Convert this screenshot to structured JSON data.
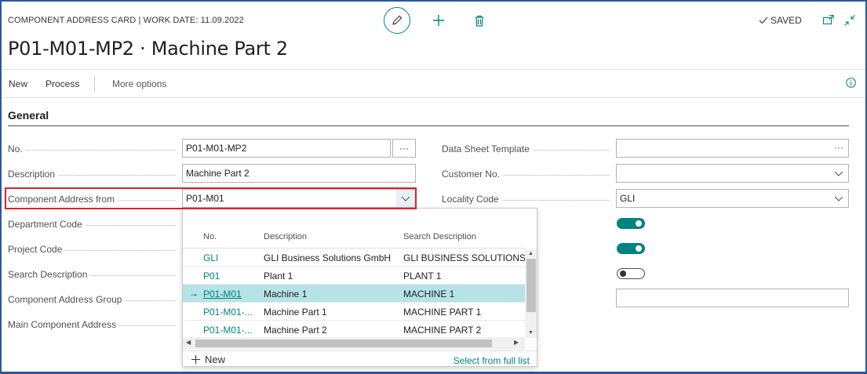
{
  "header": {
    "breadcrumb": "COMPONENT ADDRESS CARD | WORK DATE: 11.09.2022",
    "title": "P01-M01-MP2 · Machine Part 2",
    "saved_label": "SAVED"
  },
  "actions": {
    "new": "New",
    "process": "Process",
    "more": "More options"
  },
  "section": {
    "title": "General"
  },
  "fields": {
    "no": {
      "label": "No.",
      "value": "P01-M01-MP2"
    },
    "description": {
      "label": "Description",
      "value": "Machine Part 2"
    },
    "component_address_from": {
      "label": "Component Address from",
      "value": "P01-M01"
    },
    "department_code": {
      "label": "Department Code"
    },
    "project_code": {
      "label": "Project Code"
    },
    "search_description": {
      "label": "Search Description"
    },
    "component_address_group": {
      "label": "Component Address Group"
    },
    "main_component_address": {
      "label": "Main Component Address"
    },
    "data_sheet_template": {
      "label": "Data Sheet Template",
      "value": ""
    },
    "customer_no": {
      "label": "Customer No.",
      "value": ""
    },
    "locality_code": {
      "label": "Locality Code",
      "value": "GLI"
    }
  },
  "toggles": {
    "toggle1": true,
    "toggle2": true,
    "toggle3": false
  },
  "dropdown": {
    "headers": {
      "no": "No.",
      "description": "Description",
      "search_description": "Search Description"
    },
    "rows": [
      {
        "no": "GLI",
        "description": "GLI Business Solutions GmbH",
        "search_description": "GLI BUSINESS SOLUTIONS GM"
      },
      {
        "no": "P01",
        "description": "Plant 1",
        "search_description": "PLANT 1"
      },
      {
        "no": "P01-M01",
        "description": "Machine 1",
        "search_description": "MACHINE 1"
      },
      {
        "no": "P01-M01-...",
        "description": "Machine Part 1",
        "search_description": "MACHINE PART 1"
      },
      {
        "no": "P01-M01-...",
        "description": "Machine Part 2",
        "search_description": "MACHINE PART 2"
      }
    ],
    "new_label": "New",
    "full_list_label": "Select from full list"
  },
  "colors": {
    "accent": "#00827f",
    "highlight_border": "#e0202a",
    "selected_row": "#b6e3e6",
    "frame": "#2b5797"
  }
}
